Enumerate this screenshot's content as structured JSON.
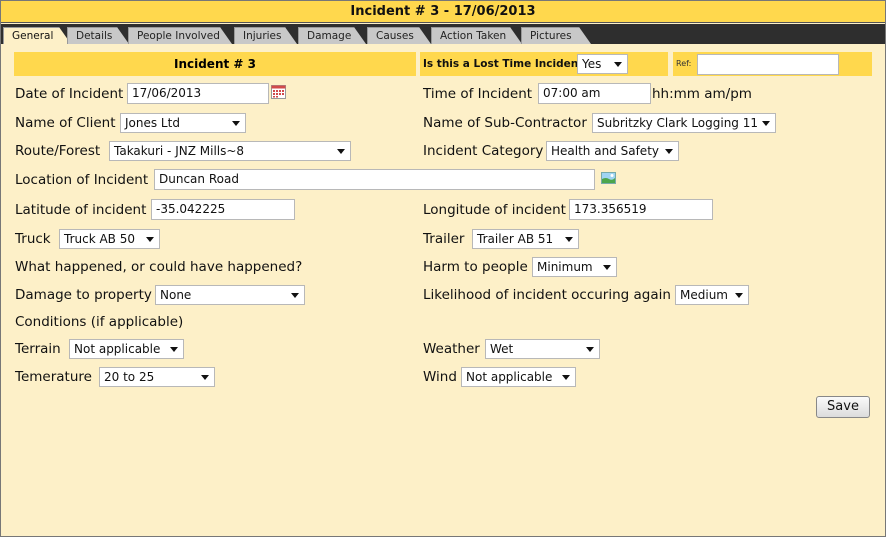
{
  "window": {
    "title": "Incident # 3 - 17/06/2013"
  },
  "tabs": [
    {
      "label": "General"
    },
    {
      "label": "Details"
    },
    {
      "label": "People Involved"
    },
    {
      "label": "Injuries"
    },
    {
      "label": "Damage"
    },
    {
      "label": "Causes"
    },
    {
      "label": "Action Taken"
    },
    {
      "label": "Pictures"
    }
  ],
  "header": {
    "title": "Incident # 3",
    "lost_time_label": "Is this a Lost Time Incident",
    "lost_time_value": "Yes",
    "ref_label": "Ref:",
    "ref_value": ""
  },
  "form": {
    "date_label": "Date of Incident",
    "date_value": "17/06/2013",
    "time_label": "Time of Incident",
    "time_value": "07:00 am",
    "time_hint": "hh:mm am/pm",
    "client_label": "Name of Client",
    "client_value": "Jones Ltd",
    "subcontractor_label": "Name of Sub-Contractor",
    "subcontractor_value": "Subritzky Clark Logging 11",
    "route_label": "Route/Forest",
    "route_value": "Takakuri - JNZ Mills~8",
    "category_label": "Incident Category",
    "category_value": "Health and Safety",
    "location_label": "Location of Incident",
    "location_value": "Duncan Road",
    "latitude_label": "Latitude of incident",
    "latitude_value": "-35.042225",
    "longitude_label": "Longitude of incident",
    "longitude_value": "173.356519",
    "truck_label": "Truck",
    "truck_value": "Truck AB 50",
    "trailer_label": "Trailer",
    "trailer_value": "Trailer AB 51",
    "what_happened_label": "What happened, or could have happened?",
    "harm_label": "Harm to people",
    "harm_value": "Minimum",
    "damage_label": "Damage to property",
    "damage_value": "None",
    "likelihood_label": "Likelihood of incident occuring again",
    "likelihood_value": "Medium",
    "conditions_label": "Conditions (if applicable)",
    "terrain_label": "Terrain",
    "terrain_value": "Not applicable",
    "weather_label": "Weather",
    "weather_value": "Wet",
    "temperature_label": "Temerature",
    "temperature_value": "20 to 25",
    "wind_label": "Wind",
    "wind_value": "Not applicable",
    "save_label": "Save"
  },
  "icons": {
    "calendar": "calendar-icon",
    "map": "map-icon"
  },
  "colors": {
    "accent": "#ffd84d",
    "panel": "#fdf0c8",
    "tabbar": "#2e2e2e"
  }
}
